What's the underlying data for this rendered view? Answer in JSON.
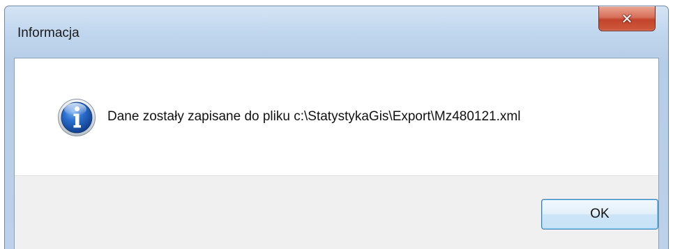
{
  "window": {
    "title": "Informacja",
    "close_glyph": "✕"
  },
  "message": {
    "icon": "info-icon",
    "text": "Dane zostały zapisane do pliku c:\\StatystykaGis\\Export\\Mz480121.xml"
  },
  "buttons": {
    "ok_label": "OK"
  },
  "colors": {
    "frame": "#c0d6ee",
    "close_button": "#c7503a",
    "info_icon": "#1f5fc0",
    "button_area": "#f0f0f0"
  }
}
